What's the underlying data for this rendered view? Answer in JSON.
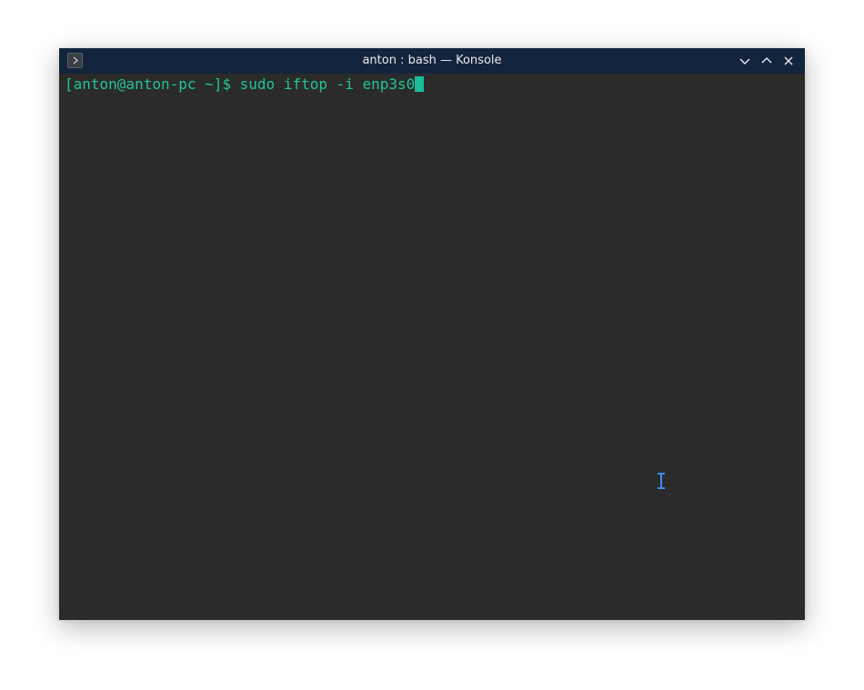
{
  "window": {
    "title": "anton : bash — Konsole",
    "app_icon": "terminal-icon",
    "controls": {
      "minimize_icon": "chevron-down-icon",
      "maximize_icon": "chevron-up-icon",
      "close_icon": "close-icon"
    }
  },
  "terminal": {
    "prompt": "[anton@anton-pc ~]$ ",
    "command": "sudo iftop -i enp3s0",
    "mouse_cursor_icon": "text-cursor-icon"
  },
  "colors": {
    "titlebar": "#13253d",
    "terminal_bg": "#2b2b2b",
    "terminal_text": "#23c497",
    "cursor_block": "#1abc9c",
    "ibeam": "#3d8ee6"
  }
}
